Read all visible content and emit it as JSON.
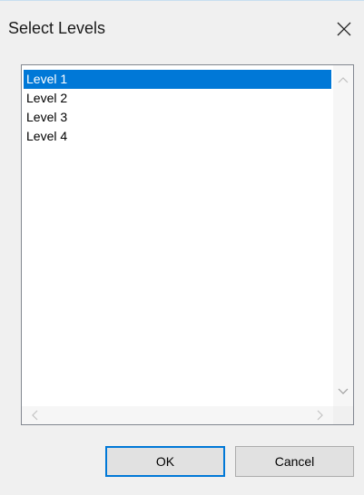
{
  "dialog": {
    "title": "Select Levels",
    "close_icon": "close-icon"
  },
  "list": {
    "items": [
      {
        "label": "Level 1",
        "selected": true
      },
      {
        "label": "Level 2",
        "selected": false
      },
      {
        "label": "Level 3",
        "selected": false
      },
      {
        "label": "Level 4",
        "selected": false
      }
    ]
  },
  "buttons": {
    "ok_label": "OK",
    "cancel_label": "Cancel"
  },
  "colors": {
    "selection": "#0078d7",
    "dialog_background": "#f0f0f0"
  }
}
